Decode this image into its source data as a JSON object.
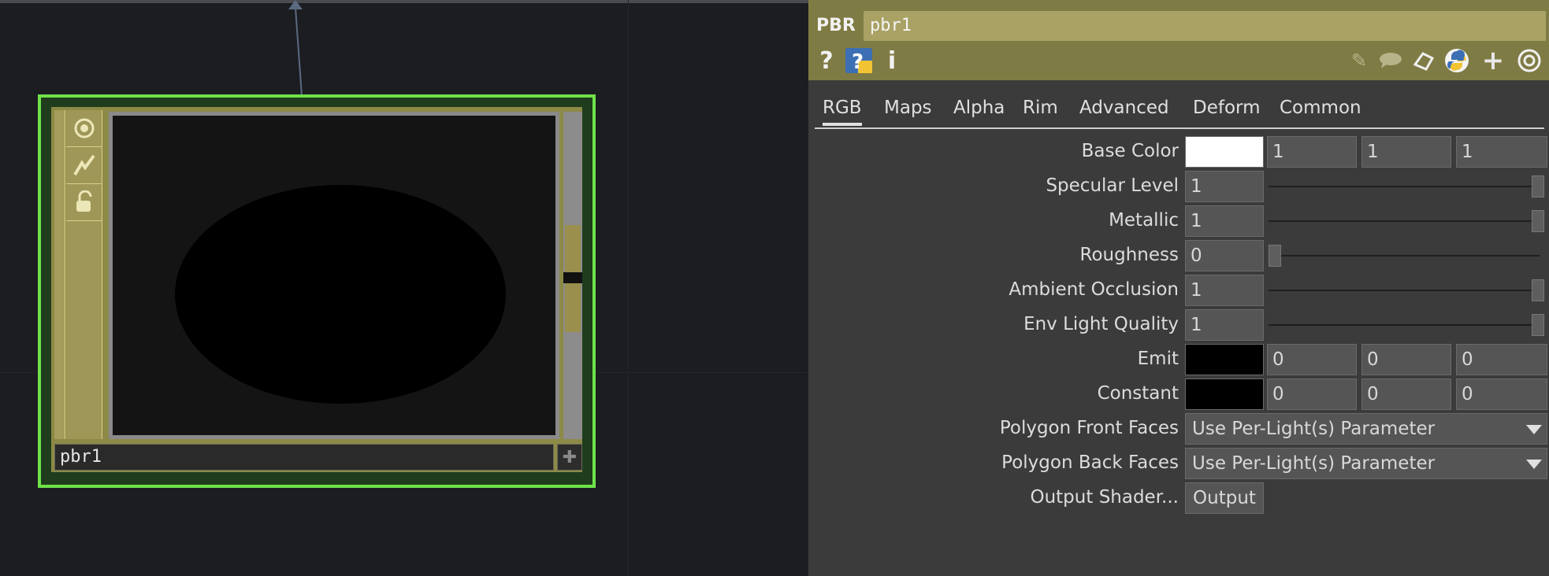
{
  "node": {
    "name": "pbr1",
    "flags": [
      "display-flag-icon",
      "cook-flag-icon",
      "lock-flag-icon"
    ]
  },
  "panel": {
    "op_type": "PBR",
    "op_name": "pbr1",
    "header_icons_left": [
      "help-icon",
      "python-help-icon",
      "info-icon"
    ],
    "header_icons_right": [
      "edit-icon",
      "comment-icon",
      "clip-icon",
      "python-icon",
      "add-icon",
      "viewer-icon"
    ],
    "tabs": [
      "RGB",
      "Maps",
      "Alpha",
      "Rim",
      "Advanced",
      "Deform",
      "Common"
    ],
    "active_tab": "RGB",
    "params": {
      "base_color": {
        "label": "Base Color",
        "swatch": "#ffffff",
        "r": "1",
        "g": "1",
        "b": "1"
      },
      "specular_level": {
        "label": "Specular Level",
        "value": "1",
        "slider": 1.0
      },
      "metallic": {
        "label": "Metallic",
        "value": "1",
        "slider": 1.0
      },
      "roughness": {
        "label": "Roughness",
        "value": "0",
        "slider": 0.0
      },
      "ambient_occlusion": {
        "label": "Ambient Occlusion",
        "value": "1",
        "slider": 1.0
      },
      "env_light_quality": {
        "label": "Env Light Quality",
        "value": "1",
        "slider": 1.0
      },
      "emit": {
        "label": "Emit",
        "swatch": "#000000",
        "r": "0",
        "g": "0",
        "b": "0"
      },
      "constant": {
        "label": "Constant",
        "swatch": "#000000",
        "r": "0",
        "g": "0",
        "b": "0"
      },
      "polygon_front_faces": {
        "label": "Polygon Front Faces",
        "value": "Use Per-Light(s) Parameter"
      },
      "polygon_back_faces": {
        "label": "Polygon Back Faces",
        "value": "Use Per-Light(s) Parameter"
      },
      "output_shader": {
        "label": "Output Shader...",
        "button": "Output"
      }
    }
  },
  "colors": {
    "node_border": "#6fe24a",
    "header_bg": "#7f7b44",
    "panel_bg": "#3b3b3b"
  }
}
